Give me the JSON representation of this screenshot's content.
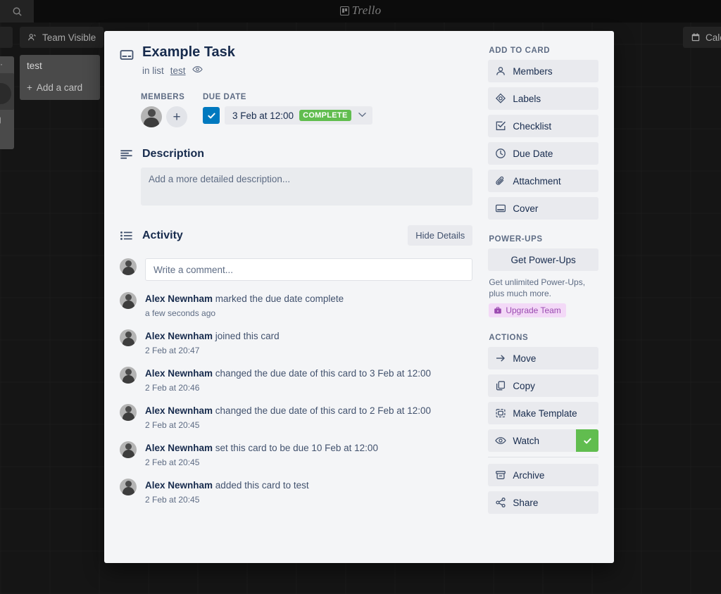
{
  "background": {
    "search_icon": "search-icon",
    "logo_text": "Trello",
    "team_visible_label": "Team Visible",
    "calendar_label": "Cale",
    "list": {
      "title": "test",
      "add_card_label": "Add a card"
    }
  },
  "modal": {
    "close_label": "✕",
    "card_icon": "card-icon",
    "title": "Example Task",
    "in_list_prefix": "in list",
    "list_name": "test",
    "watch_icon": "eye-icon",
    "members_label": "MEMBERS",
    "add_member_label": "+",
    "due_date_label": "DUE DATE",
    "due_date_value": "3 Feb at 12:00",
    "due_complete_badge": "COMPLETE",
    "due_chevron": "⌄",
    "description": {
      "heading": "Description",
      "placeholder": "Add a more detailed description..."
    },
    "activity": {
      "heading": "Activity",
      "hide_details_label": "Hide Details",
      "comment_placeholder": "Write a comment...",
      "entries": [
        {
          "author": "Alex Newnham",
          "action": "marked the due date complete",
          "time": "a few seconds ago"
        },
        {
          "author": "Alex Newnham",
          "action": "joined this card",
          "time": "2 Feb at 20:47"
        },
        {
          "author": "Alex Newnham",
          "action": "changed the due date of this card to 3 Feb at 12:00",
          "time": "2 Feb at 20:46"
        },
        {
          "author": "Alex Newnham",
          "action": "changed the due date of this card to 2 Feb at 12:00",
          "time": "2 Feb at 20:45"
        },
        {
          "author": "Alex Newnham",
          "action": "set this card to be due 10 Feb at 12:00",
          "time": "2 Feb at 20:45"
        },
        {
          "author": "Alex Newnham",
          "action": "added this card to test",
          "time": "2 Feb at 20:45"
        }
      ]
    },
    "sidebar": {
      "add_to_card_heading": "ADD TO CARD",
      "add_to_card_items": [
        {
          "label": "Members",
          "icon": "person-icon"
        },
        {
          "label": "Labels",
          "icon": "label-icon"
        },
        {
          "label": "Checklist",
          "icon": "checklist-icon"
        },
        {
          "label": "Due Date",
          "icon": "clock-icon"
        },
        {
          "label": "Attachment",
          "icon": "paperclip-icon"
        },
        {
          "label": "Cover",
          "icon": "cover-icon"
        }
      ],
      "power_ups_heading": "POWER-UPS",
      "get_power_ups_label": "Get Power-Ups",
      "power_ups_note": "Get unlimited Power-Ups, plus much more.",
      "upgrade_label": "Upgrade Team",
      "actions_heading": "ACTIONS",
      "action_items": [
        {
          "label": "Move",
          "icon": "arrow-right-icon"
        },
        {
          "label": "Copy",
          "icon": "copy-icon"
        },
        {
          "label": "Make Template",
          "icon": "template-icon"
        },
        {
          "label": "Watch",
          "icon": "eye-icon",
          "checked": true
        }
      ],
      "action_items_secondary": [
        {
          "label": "Archive",
          "icon": "archive-icon"
        },
        {
          "label": "Share",
          "icon": "share-icon"
        }
      ]
    }
  },
  "colors": {
    "accent_blue": "#0079bf",
    "green": "#61bd4f",
    "purple": "#9a4ab0",
    "text_dark": "#172b4d",
    "text_muted": "#5e6c84"
  }
}
